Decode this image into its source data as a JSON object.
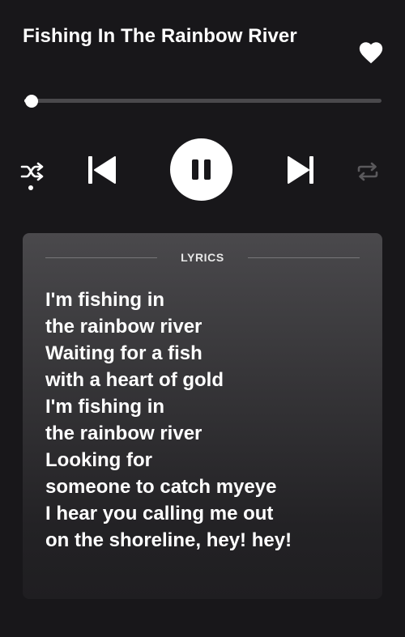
{
  "track": {
    "title": "Fishing In The Rainbow River",
    "liked": true
  },
  "playback": {
    "progress": 0.02,
    "state": "playing",
    "shuffle": true,
    "repeat": false
  },
  "icons": {
    "like": "heart-icon",
    "shuffle": "shuffle-icon",
    "previous": "skip-previous-icon",
    "pause": "pause-icon",
    "next": "skip-next-icon",
    "repeat": "repeat-icon"
  },
  "colors": {
    "background": "#18171a",
    "accent": "#ffffff",
    "track": "#4a494c",
    "inactive_icon": "#5a595c"
  },
  "lyrics": {
    "label": "LYRICS",
    "lines": [
      "I'm fishing in",
      "the rainbow river",
      "Waiting for a fish",
      "with a heart of gold",
      "I'm fishing in",
      "the rainbow river",
      "Looking for",
      "someone to catch myeye",
      "I hear you calling me out",
      "on the shoreline, hey! hey!"
    ]
  }
}
